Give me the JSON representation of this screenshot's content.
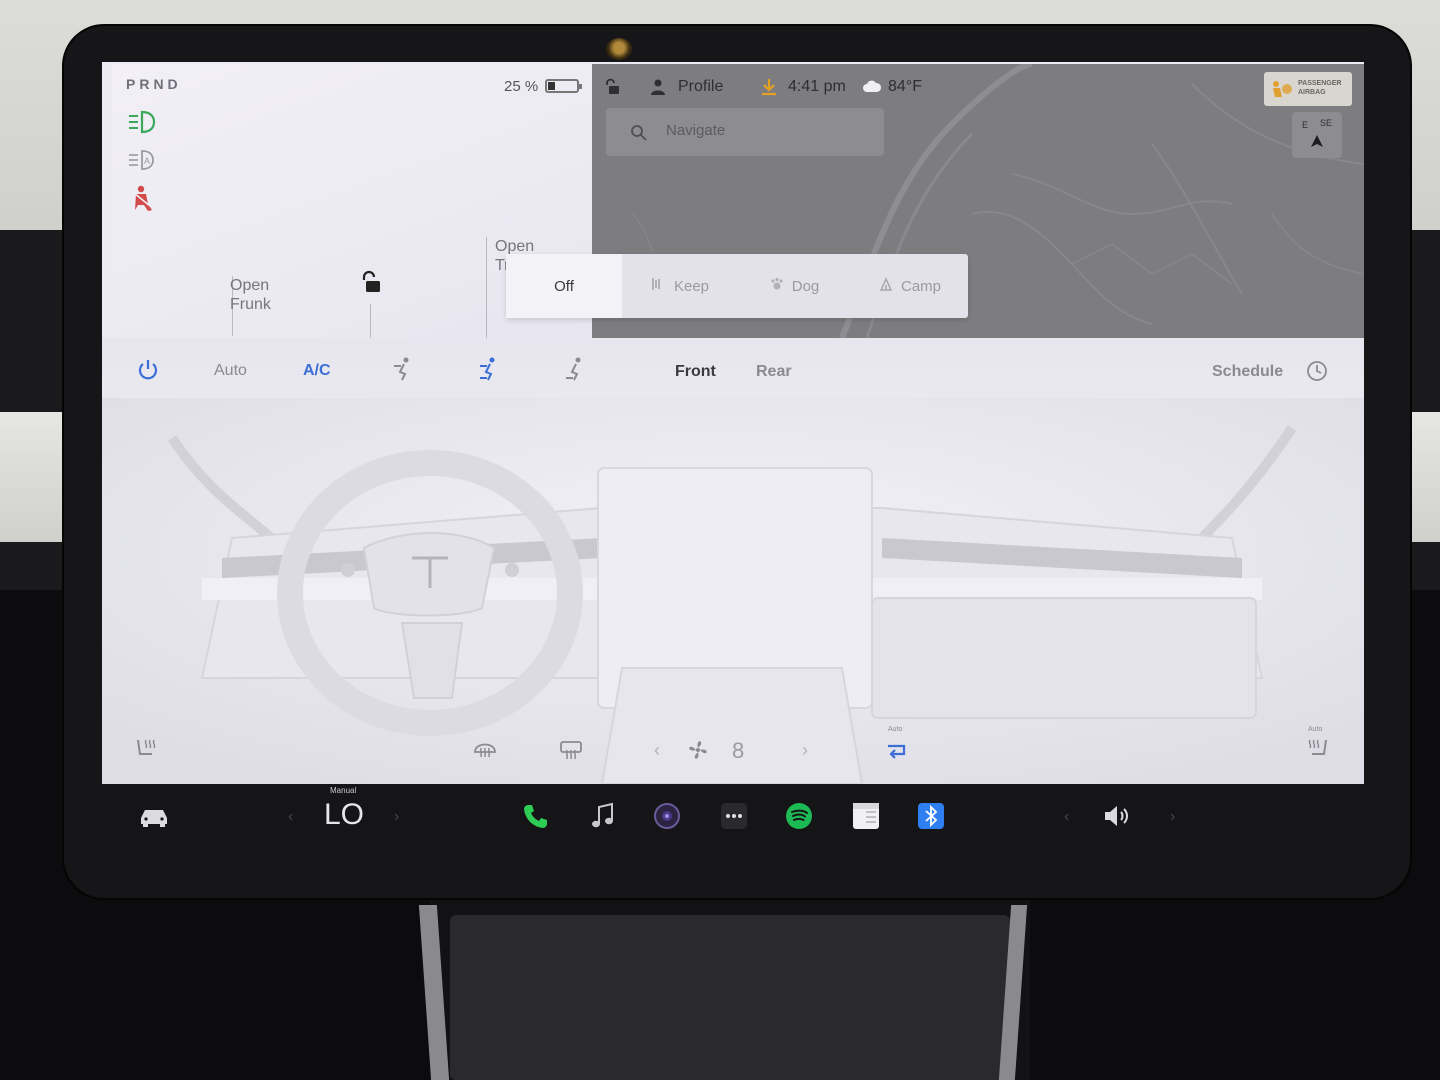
{
  "status": {
    "gear": "PRND",
    "battery_percent_text": "25 %",
    "battery_level": 0.25
  },
  "car_panel": {
    "frunk_line1": "Open",
    "frunk_line2": "Frunk",
    "trunk_line1": "Open",
    "trunk_line2": "Tr"
  },
  "topbar": {
    "profile": "Profile",
    "time": "4:41 pm",
    "temperature": "84°F"
  },
  "map": {
    "search_placeholder": "Navigate",
    "airbag_line1": "PASSENGER",
    "airbag_line2": "AIRBAG",
    "compass_e": "E",
    "compass_se": "SE"
  },
  "sentry": {
    "options": [
      "Off",
      "Keep",
      "Dog",
      "Camp"
    ],
    "selected": "Off"
  },
  "climate": {
    "auto_label": "Auto",
    "ac_label": "A/C",
    "front_label": "Front",
    "rear_label": "Rear",
    "schedule_label": "Schedule",
    "fan_speed": "8",
    "recirc_auto_label": "Auto",
    "seat_right_auto_label": "Auto"
  },
  "taskbar": {
    "temp_mode": "Manual",
    "temp_value": "LO"
  },
  "colors": {
    "accent_blue": "#3b6fd6",
    "headlight_green": "#3aa85a",
    "seatbelt_red": "#d24a4a",
    "phone_green": "#2ecc55",
    "spotify_green": "#1db954",
    "bluetooth_blue": "#2f7ff0"
  }
}
